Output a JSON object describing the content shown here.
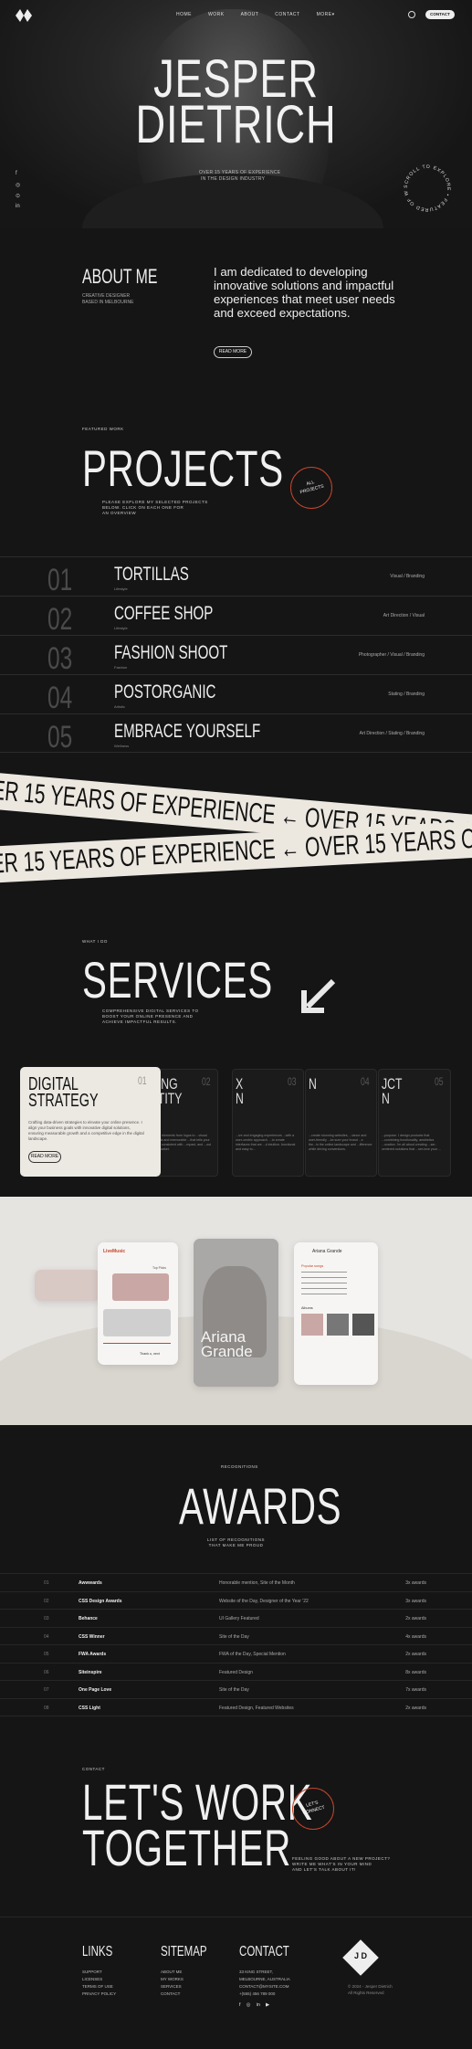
{
  "nav": {
    "items": [
      "HOME",
      "WORK",
      "ABOUT",
      "CONTACT",
      "MORE"
    ],
    "more_caret": "▾",
    "contact_button": "CONTACT"
  },
  "hero": {
    "title_line1": "JESPER",
    "title_line2": "DIETRICH",
    "subtitle_line1": "OVER 15 YEARS OF EXPERIENCE",
    "subtitle_line2": "IN THE DESIGN INDUSTRY",
    "social": [
      "f",
      "◎",
      "⊙",
      "in"
    ],
    "scroll_badge": "SCROLL TO EXPLORE • FEATURED OF WORKS •"
  },
  "about": {
    "heading": "ABOUT ME",
    "small_line1": "CREATIVE DESIGNER",
    "small_line2": "BASED IN MELBOURNE",
    "text": "I am dedicated to developing innovative solutions and impactful experiences that meet user needs and exceed expectations.",
    "button": "READ MORE"
  },
  "projects": {
    "eyebrow": "FEATURED WORK",
    "heading": "PROJECTS",
    "intro_line1": "PLEASE EXPLORE MY SELECTED PROJECTS",
    "intro_line2": "BELOW. CLICK ON EACH ONE FOR",
    "intro_line3": "AN OVERVIEW",
    "all_projects_line1": "ALL",
    "all_projects_line2": "PROJECTS",
    "items": [
      {
        "num": "01",
        "name": "TORTILLAS",
        "cat": "Lifestyle",
        "tags": "Visual / Branding"
      },
      {
        "num": "02",
        "name": "COFFEE SHOP",
        "cat": "Lifestyle",
        "tags": "Art Direction / Visual"
      },
      {
        "num": "03",
        "name": "FASHION SHOOT",
        "cat": "Fashion",
        "tags": "Photographer / Visual / Branding"
      },
      {
        "num": "04",
        "name": "POSTORGANIC",
        "cat": "Artistic",
        "tags": "Stating / Branding"
      },
      {
        "num": "05",
        "name": "EMBRACE YOURSELF",
        "cat": "Wellness",
        "tags": "Art Direction / Stating / Branding"
      }
    ]
  },
  "ribbons": {
    "top": "OVER 15 YEARS OF EXPERIENCE  ←  OVER 15 YEARS OF",
    "bottom": "OVER 15 YEARS OF EXPERIENCE  ←  OVER 15 YEARS OF"
  },
  "services": {
    "eyebrow": "WHAT I DO",
    "heading": "SERVICES",
    "intro_line1": "COMPREHENSIVE DIGITAL SERVICES TO",
    "intro_line2": "BOOST YOUR ONLINE PRESENCE AND",
    "intro_line3": "ACHIEVE IMPACTFUL RESULTS.",
    "main_card": {
      "title_line1": "DIGITAL",
      "title_line2": "STRATEGY",
      "number": "01",
      "desc": "Crafting data-driven strategies to elevate your online presence. I align your business goals with innovative digital solutions, ensuring measurable growth and a competitive edge in the digital landscape.",
      "button": "READ MORE"
    },
    "cards": [
      {
        "title_line1": "DING",
        "title_line2": "NTITY",
        "number": "02",
        "desc": "...visual elements from logos to ...visual concepts and memorable ...that tells your unique, consistent with ...mpact, and ...out in the market."
      },
      {
        "title_line1": "X",
        "title_line2": "N",
        "number": "03",
        "desc": "...ive and engaging experiences ...with a user-centric approach. ...to create interfaces that are ...d intuitive, functional and easy to..."
      },
      {
        "title_line1": "",
        "title_line2": "N",
        "number": "04",
        "desc": "...create stunning websites, ...tance and user-friendly ...ke sure your brand ...s the...in the online landscape and ...ifference while driving conversions."
      },
      {
        "title_line1": "JCT",
        "title_line2": "N",
        "number": "05",
        "desc": "...purpose. I design products that ...combining functionality, aesthetics ...ovation. I'm all about creating ...ser-centered solutions that ...ser-love your ..."
      }
    ]
  },
  "showcase": {
    "app_name": "LiveMusic",
    "artist_line1": "Ariana",
    "artist_line2": "Grande",
    "panel_title": "Ariana Grande",
    "track_label": "Thank u, next",
    "popular_label": "Popular songs",
    "albums_label": "Albums",
    "top_picks": "Top Picks"
  },
  "awards": {
    "eyebrow": "RECOGNITIONS",
    "heading": "AWARDS",
    "intro_line1": "LIST OF RECOGNITIONS",
    "intro_line2": "THAT MAKE ME PROUD",
    "rows": [
      {
        "num": "01",
        "name": "Awwwards",
        "desc": "Honorable mention, Site of the Month",
        "count": "3x awards"
      },
      {
        "num": "02",
        "name": "CSS Design Awards",
        "desc": "Website of the Day, Designer of the Year '22",
        "count": "3x awards"
      },
      {
        "num": "03",
        "name": "Behance",
        "desc": "UI Gallery Featured",
        "count": "2x awards"
      },
      {
        "num": "04",
        "name": "CSS Winner",
        "desc": "Site of the Day",
        "count": "4x awards"
      },
      {
        "num": "05",
        "name": "FWA Awards",
        "desc": "FWA of the Day, Special Mention",
        "count": "2x awards"
      },
      {
        "num": "06",
        "name": "Siteinspire",
        "desc": "Featured Design",
        "count": "8x awards"
      },
      {
        "num": "07",
        "name": "One Page Love",
        "desc": "Site of the Day",
        "count": "7x awards"
      },
      {
        "num": "08",
        "name": "CSS Light",
        "desc": "Featured Design, Featured Websites",
        "count": "2x awards"
      }
    ]
  },
  "contact": {
    "eyebrow": "CONTACT",
    "heading_line1": "LET'S WORK",
    "heading_line2": "TOGETHER",
    "badge_line1": "LET'S",
    "badge_line2": "CONNECT",
    "text_line1": "FEELING GOOD ABOUT A NEW PROJECT?",
    "text_line2": "WRITE ME WHAT'S IN YOUR MIND",
    "text_line3": "AND LET'S TALK ABOUT IT!"
  },
  "footer": {
    "links_heading": "LINKS",
    "links": [
      "SUPPORT",
      "LICENSES",
      "TERMS OF USE",
      "PRIVACY POLICY"
    ],
    "sitemap_heading": "SITEMAP",
    "sitemap": [
      "ABOUT ME",
      "MY WORKS",
      "SERVICES",
      "CONTACT"
    ],
    "contact_heading": "CONTACT",
    "contact_lines": [
      "33 KING STREET,",
      "MELBOURNE, AUSTRALIA",
      "CONTACT@MYSITE.COM",
      "+(555) 456 789 000"
    ],
    "social": [
      "f",
      "◎",
      "in",
      "▶"
    ],
    "logo_letters": "J D",
    "copyright_line1": "© 2024 - Jesper Dietrich",
    "copyright_line2": "All Rights Reserved"
  },
  "colors": {
    "bg": "#151515",
    "accent": "#c4452b",
    "light": "#ece9e2"
  }
}
